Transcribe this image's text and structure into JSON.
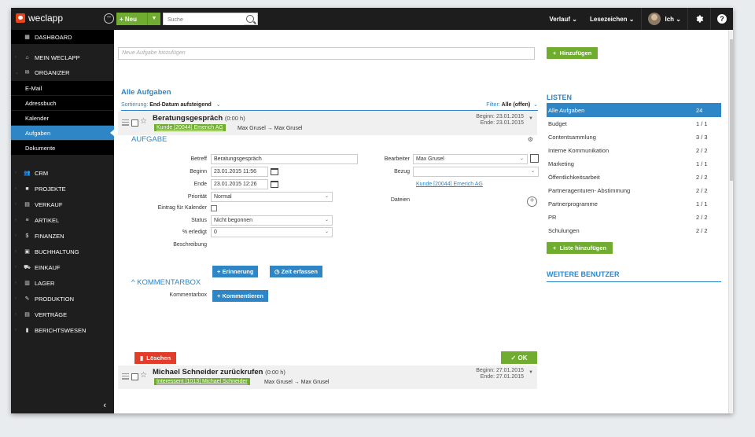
{
  "app": {
    "logo_text": "weclapp"
  },
  "topbar": {
    "new_label": "+ Neu",
    "search_placeholder": "Suche",
    "verlauf": "Verlauf",
    "lesezeichen": "Lesezeichen",
    "user": "Ich"
  },
  "sidebar": {
    "dashboard": "DASHBOARD",
    "mein_weclapp": "MEIN WECLAPP",
    "organizer": "ORGANIZER",
    "sub": [
      "E-Mail",
      "Adressbuch",
      "Kalender",
      "Aufgaben",
      "Dokumente"
    ],
    "modules": [
      "CRM",
      "PROJEKTE",
      "VERKAUF",
      "ARTIKEL",
      "FINANZEN",
      "BUCHHALTUNG",
      "EINKAUF",
      "LAGER",
      "PRODUKTION",
      "VERTRÄGE",
      "BERICHTSWESEN"
    ]
  },
  "main": {
    "new_task_placeholder": "Neue Aufgabe hinzufügen",
    "heading": "Alle Aufgaben",
    "sort_label": "Sortierung:",
    "sort_value": "End-Datum aufsteigend",
    "filter_label": "Filter:",
    "filter_value": "Alle (offen)"
  },
  "task1": {
    "title": "Beratungsgespräch",
    "duration": "(0:00 h)",
    "tag": "Kunde [20044] Emerich AG",
    "flow": "Max Grusel → Max Grusel",
    "begin": "Beginn: 23.01.2015",
    "end": "Ende: 23.01.2015"
  },
  "detail": {
    "heading": "AUFGABE",
    "betreff_label": "Betreff",
    "betreff": "Beratungsgespräch",
    "beginn_label": "Beginn",
    "beginn": "23.01.2015 11:56",
    "ende_label": "Ende",
    "ende": "23.01.2015 12:26",
    "prioritaet_label": "Priorität",
    "prioritaet": "Normal",
    "kalender_label": "Eintrag für Kalender",
    "status_label": "Status",
    "status": "Nicht begonnen",
    "erledigt_label": "% erledigt",
    "erledigt": "0",
    "beschreibung_label": "Beschreibung",
    "bearbeiter_label": "Bearbeiter",
    "bearbeiter": "Max Grusel",
    "bezug_label": "Bezug",
    "bezug_link": "Kunde [20044] Emerich AG",
    "dateien_label": "Dateien",
    "erinnerung_btn": "+ Erinnerung",
    "zeit_btn": "Zeit erfassen",
    "komm_heading": "KOMMENTARBOX",
    "komm_label": "Kommentarbox",
    "komm_btn": "+ Kommentieren",
    "loeschen_btn": "Löschen",
    "ok_btn": "OK"
  },
  "task2": {
    "title": "Michael Schneider zurückrufen",
    "duration": "(0:00 h)",
    "tag": "Interessent [1013] Michael Schneider",
    "flow": "Max Grusel → Max Grusel",
    "begin": "Beginn: 27.01.2015",
    "end": "Ende: 27.01.2015"
  },
  "right": {
    "hinzufuegen_btn": "Hinzufügen",
    "listen_heading": "LISTEN",
    "lists": [
      {
        "name": "Alle Aufgaben",
        "count": "24"
      },
      {
        "name": "Budget",
        "count": "1 / 1"
      },
      {
        "name": "Contentsammlung",
        "count": "3 / 3"
      },
      {
        "name": "Interne Kommunikation",
        "count": "2 / 2"
      },
      {
        "name": "Marketing",
        "count": "1 / 1"
      },
      {
        "name": "Öffentlichkeitsarbeit",
        "count": "2 / 2"
      },
      {
        "name": "Partneragenturen- Abstimmung",
        "count": "2 / 2"
      },
      {
        "name": "Partnerprogramme",
        "count": "1 / 1"
      },
      {
        "name": "PR",
        "count": "2 / 2"
      },
      {
        "name": "Schulungen",
        "count": "2 / 2"
      }
    ],
    "liste_btn": "Liste hinzufügen",
    "weitere_heading": "WEITERE BENUTZER"
  }
}
